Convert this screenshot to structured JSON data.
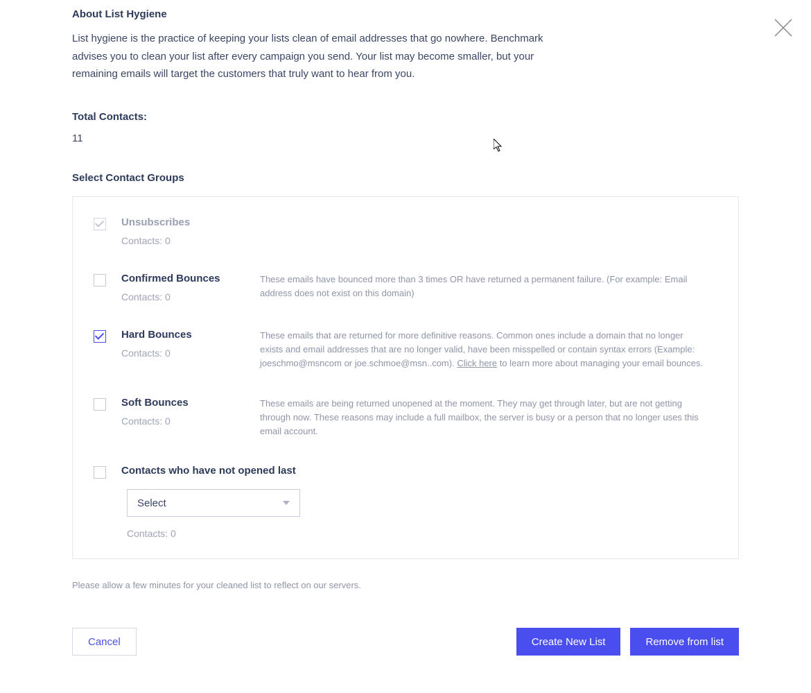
{
  "header": {
    "title": "About List Hygiene",
    "description": "List hygiene is the practice of keeping your lists clean of email addresses that go nowhere. Benchmark advises you to clean your list after every campaign you send. Your list may become smaller, but your remaining emails will target the customers that truly want to hear from you."
  },
  "total": {
    "label": "Total Contacts:",
    "value": "11"
  },
  "groups": {
    "title": "Select Contact Groups",
    "contacts_prefix": "Contacts: ",
    "items": {
      "unsubscribes": {
        "name": "Unsubscribes",
        "count": "0"
      },
      "confirmed": {
        "name": "Confirmed Bounces",
        "count": "0",
        "desc": "These emails have bounced more than 3 times OR have returned a permanent failure. (For example: Email address does not exist on this domain)"
      },
      "hard": {
        "name": "Hard Bounces",
        "count": "0",
        "desc_pre": "These emails that are returned for more definitive reasons. Common ones include a domain that no longer exists and email addresses that are no longer valid, have been misspelled or contain syntax errors (Example: joeschmo@msncom or joe.schmoe@msn..com). ",
        "link": "Click here",
        "desc_post": " to learn more about managing your email bounces."
      },
      "soft": {
        "name": "Soft Bounces",
        "count": "0",
        "desc": "These emails are being returned unopened at the moment. They may get through later, but are not getting through now. These reasons may include a full mailbox, the server is busy or a person that no longer uses this email account."
      },
      "not_opened": {
        "name": "Contacts who have not opened last",
        "count": "0",
        "select_placeholder": "Select"
      }
    }
  },
  "note": "Please allow a few minutes for your cleaned list to reflect on our servers.",
  "footer": {
    "cancel": "Cancel",
    "create": "Create New List",
    "remove": "Remove from list"
  }
}
